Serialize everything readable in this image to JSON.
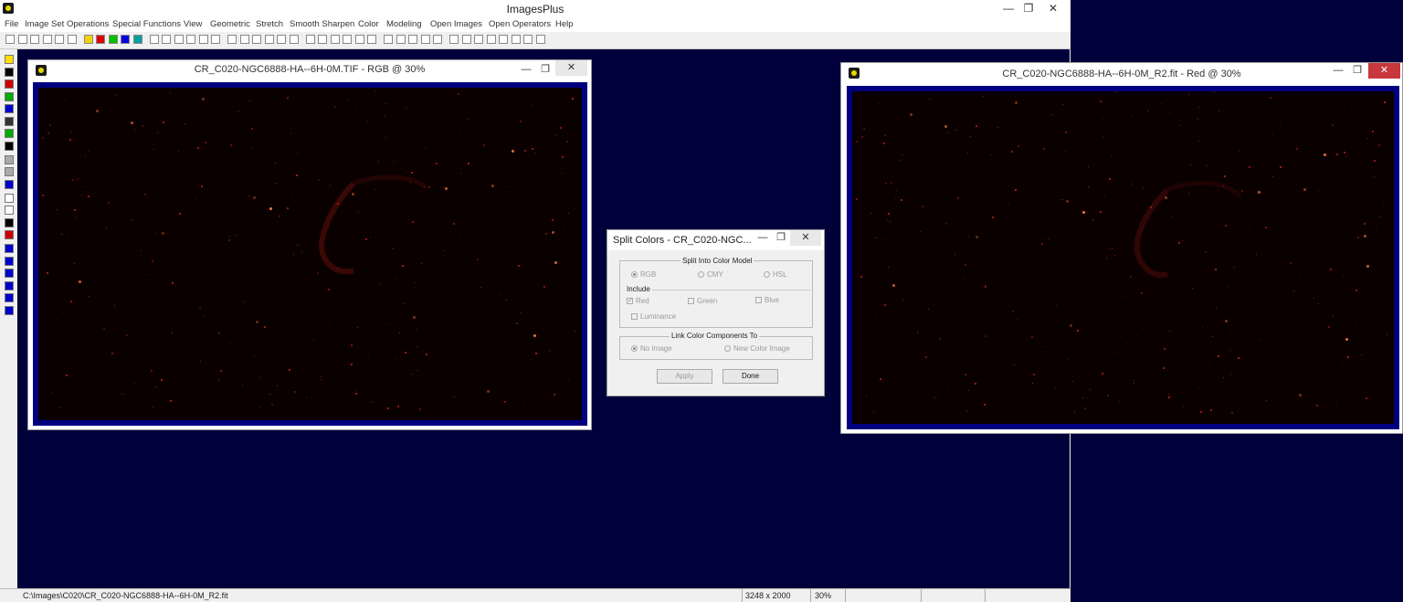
{
  "app": {
    "title": "ImagesPlus",
    "window_controls": {
      "minimize": "—",
      "maximize": "❐",
      "close": "✕"
    }
  },
  "menu": [
    "File",
    "Image Set Operations",
    "Special Functions",
    "View",
    "Geometric",
    "Stretch",
    "Smooth Sharpen",
    "Color",
    "Modeling",
    "Open Images",
    "Open Operators",
    "Help"
  ],
  "status": {
    "path": "C:\\Images\\C020\\CR_C020-NGC6888-HA--6H-0M_R2.fit",
    "dimensions": "3248 x 2000",
    "zoom": "30%"
  },
  "image_windows": [
    {
      "title": "CR_C020-NGC6888-HA--6H-0M.TIF - RGB @ 30%",
      "close_active": false
    },
    {
      "title": "CR_C020-NGC6888-HA--6H-0M_R2.fit - Red @ 30%",
      "close_active": true
    }
  ],
  "dialog": {
    "title": "Split Colors - CR_C020-NGC...",
    "group_model": "Split Into Color Model",
    "models": [
      {
        "label": "RGB",
        "selected": true
      },
      {
        "label": "CMY",
        "selected": false
      },
      {
        "label": "HSL",
        "selected": false
      }
    ],
    "group_include": "Include",
    "include": [
      {
        "label": "Red",
        "checked": true
      },
      {
        "label": "Green",
        "checked": false
      },
      {
        "label": "Blue",
        "checked": false
      },
      {
        "label": "Luminance",
        "checked": false
      }
    ],
    "group_link": "Link Color Components To",
    "link": [
      {
        "label": "No Image",
        "selected": true
      },
      {
        "label": "New Color Image",
        "selected": false
      }
    ],
    "apply": "Apply",
    "done": "Done"
  },
  "colors": {
    "desktop": "#00003a",
    "image_frame": "#000080",
    "close_red": "#c7373b"
  }
}
